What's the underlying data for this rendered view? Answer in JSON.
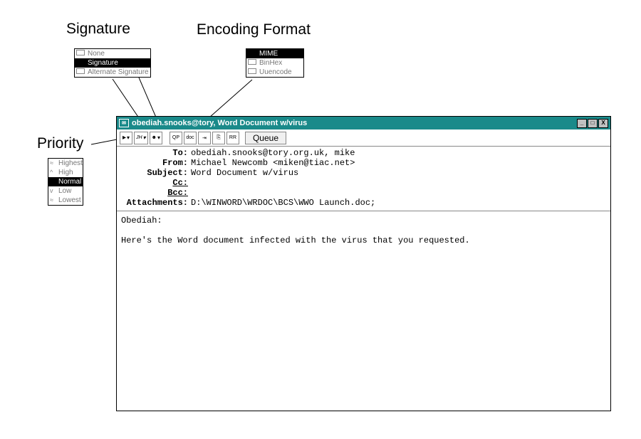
{
  "labels": {
    "signature": "Signature",
    "encoding": "Encoding Format",
    "priority": "Priority"
  },
  "popups": {
    "signature": {
      "items": [
        {
          "label": "None",
          "icon": true,
          "selected": false
        },
        {
          "label": "Signature",
          "icon": false,
          "selected": true
        },
        {
          "label": "Alternate Signature",
          "icon": true,
          "selected": false
        }
      ]
    },
    "encoding": {
      "items": [
        {
          "label": "MIME",
          "icon": false,
          "selected": true
        },
        {
          "label": "BinHex",
          "icon": true,
          "selected": false
        },
        {
          "label": "Uuencode",
          "icon": true,
          "selected": false
        }
      ]
    },
    "priority": {
      "items": [
        {
          "label": "Highest",
          "tick": "≈",
          "selected": false
        },
        {
          "label": "High",
          "tick": "^",
          "selected": false
        },
        {
          "label": "Normal",
          "tick": "",
          "selected": true
        },
        {
          "label": "Low",
          "tick": "v",
          "selected": false
        },
        {
          "label": "Lowest",
          "tick": "≈",
          "selected": false
        }
      ]
    }
  },
  "window": {
    "title": "obediah.snooks@tory, Word Document w/virus",
    "controls": {
      "min": "_",
      "max": "□",
      "close": "X"
    },
    "toolbar": {
      "queue_label": "Queue",
      "btn_qp": "QP",
      "btn_doc": "doc",
      "btn_rr": "RR"
    },
    "headers": {
      "to": {
        "label": "To:",
        "value": "obediah.snooks@tory.org.uk, mike"
      },
      "from": {
        "label": "From:",
        "value": "Michael Newcomb <miken@tiac.net>"
      },
      "subject": {
        "label": "Subject:",
        "value": "Word Document w/virus"
      },
      "cc": {
        "label": "Cc:",
        "value": ""
      },
      "bcc": {
        "label": "Bcc:",
        "value": ""
      },
      "attachments": {
        "label": "Attachments:",
        "value": "D:\\WINWORD\\WRDOC\\BCS\\WWO Launch.doc;"
      }
    },
    "body": "Obediah:\n\nHere's the Word document infected with the virus that you requested."
  }
}
